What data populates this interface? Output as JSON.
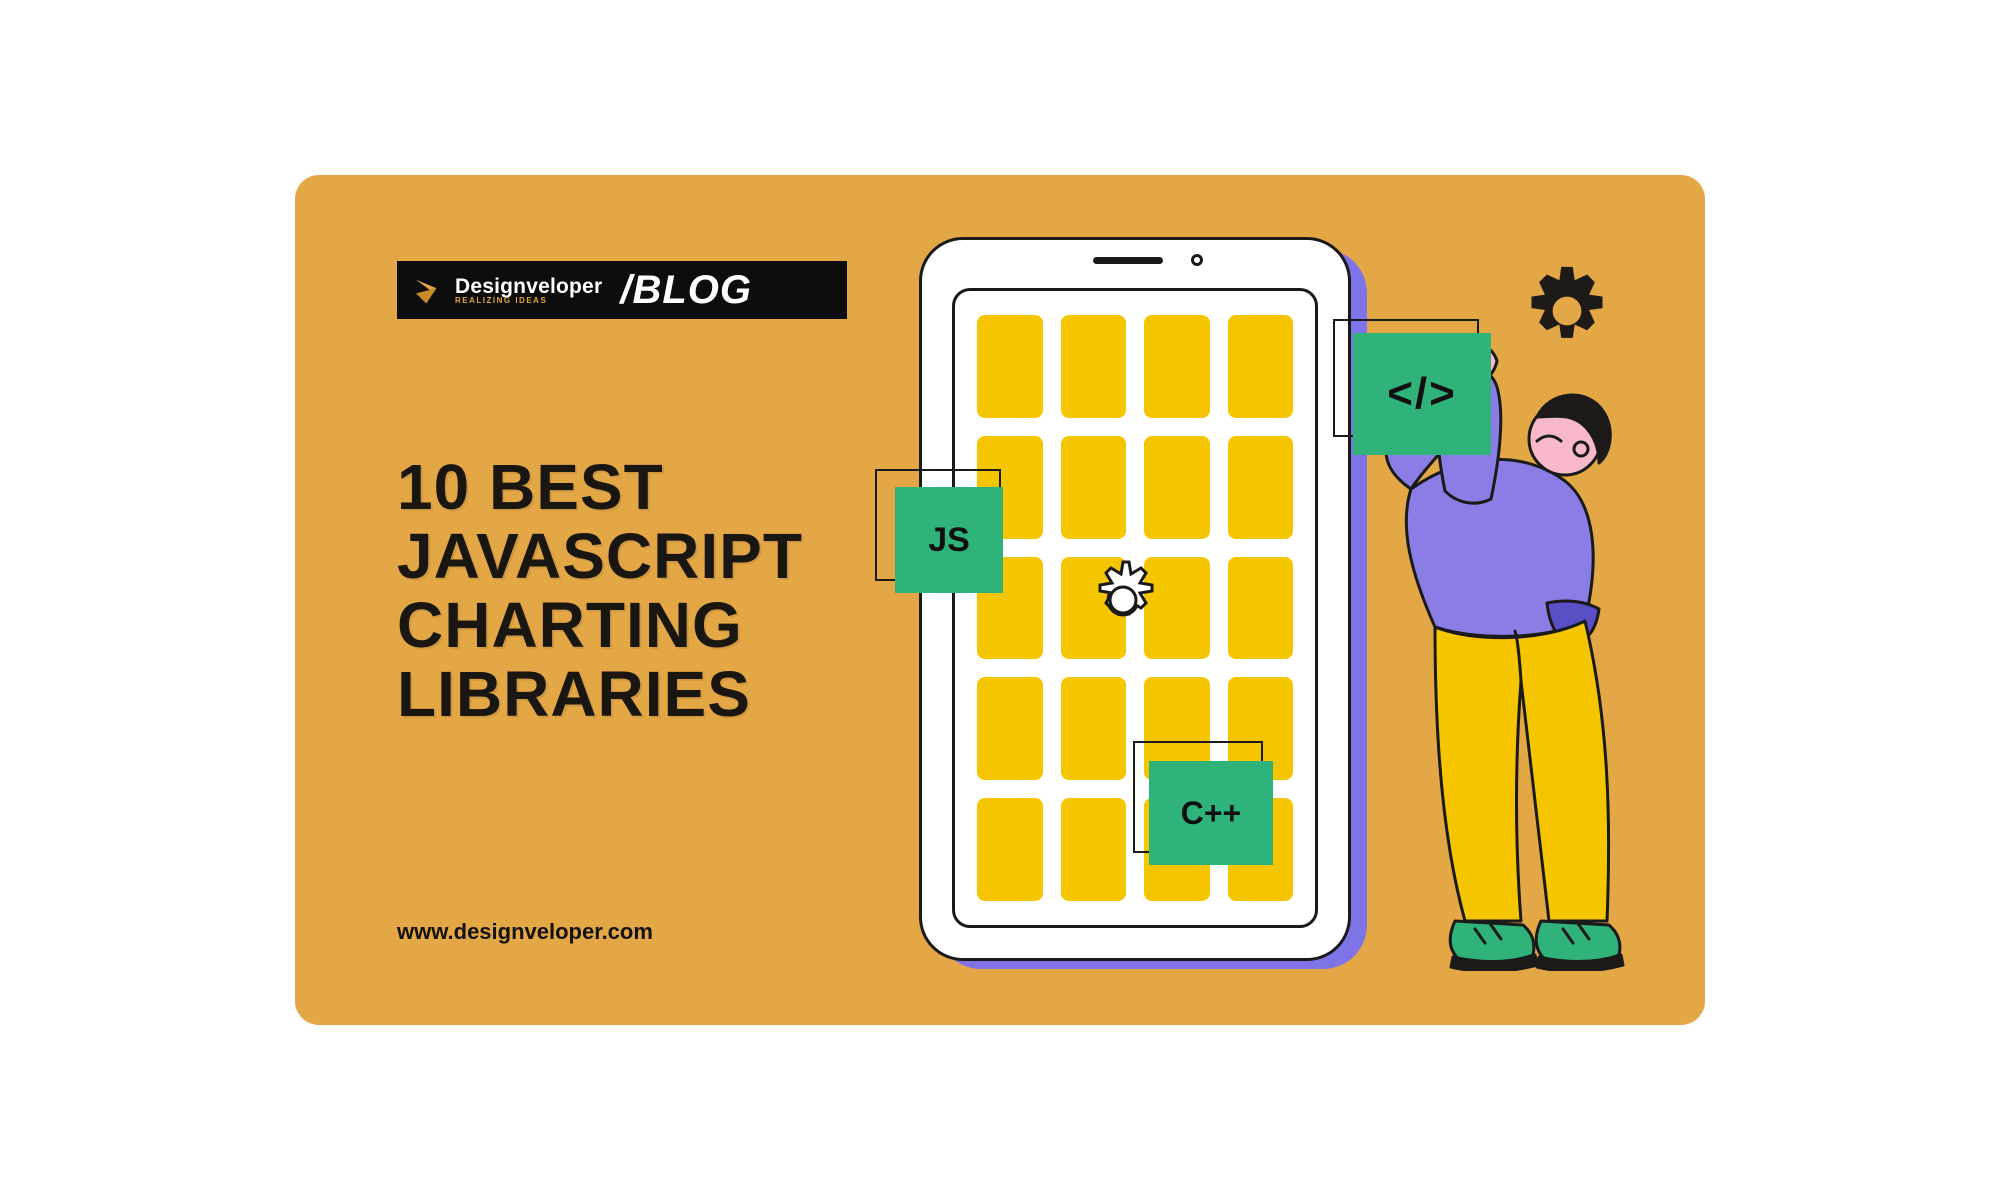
{
  "logo": {
    "brand": "Designveloper",
    "tagline": "REALIZING IDEAS",
    "blog_label": "/BLOG"
  },
  "headline": {
    "l1": "10 BEST",
    "l2": "JAVASCRIPT",
    "l3": "CHARTING",
    "l4": "LIBRARIES"
  },
  "url": "www.designveloper.com",
  "chips": {
    "js": "JS",
    "cpp": "C++",
    "code": "</>"
  },
  "colors": {
    "background": "#e3a746",
    "tile": "#f5c500",
    "chip": "#2fb37a",
    "accent_purple": "#7e74e7",
    "ink": "#1a1a1a"
  }
}
